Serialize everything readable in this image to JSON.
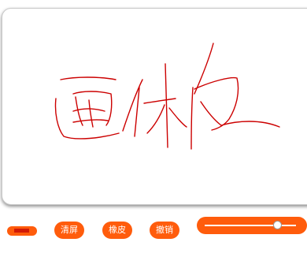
{
  "canvas": {
    "stroke_color": "#cc0000"
  },
  "toolbar": {
    "brush_color": "#d11a06",
    "accent_color": "#ff5c0c",
    "clear_label": "清屏",
    "eraser_label": "橡皮",
    "undo_label": "撤销",
    "brush_size_fraction": 0.8
  }
}
